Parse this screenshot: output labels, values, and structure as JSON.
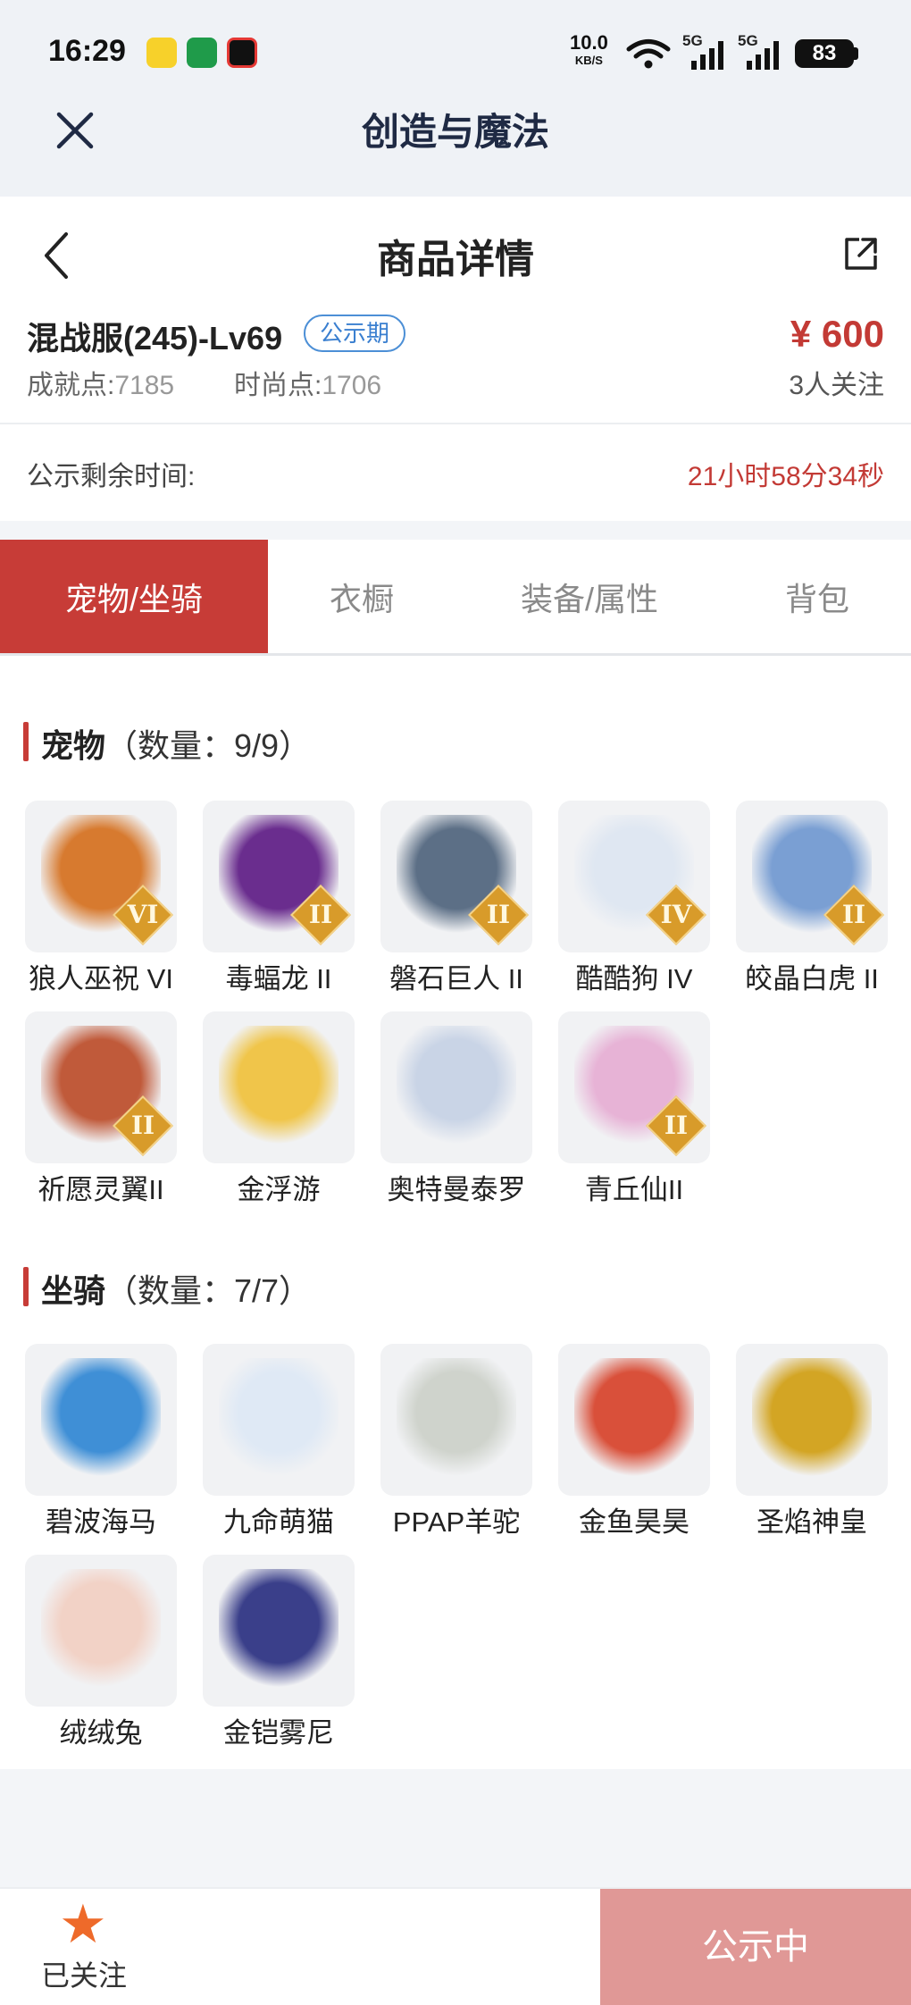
{
  "status_bar": {
    "time": "16:29",
    "net_speed": "10.0",
    "net_unit": "KB/S",
    "signal1": "5G",
    "signal2": "5G",
    "battery": "83"
  },
  "app": {
    "title": "创造与魔法"
  },
  "page": {
    "title": "商品详情"
  },
  "product": {
    "name": "混战服(245)-Lv69",
    "status_tag": "公示期",
    "price": "¥ 600",
    "achievement_label": "成就点:",
    "achievement_value": "7185",
    "fashion_label": "时尚点:",
    "fashion_value": "1706",
    "followers": "3人关注"
  },
  "timer": {
    "label": "公示剩余时间:",
    "value": "21小时58分34秒"
  },
  "tabs": [
    {
      "label": "宠物/坐骑"
    },
    {
      "label": "衣橱"
    },
    {
      "label": "装备/属性"
    },
    {
      "label": "背包"
    }
  ],
  "pets": {
    "title": "宠物",
    "count": "（数量：9/9）",
    "items": [
      {
        "name": "狼人巫祝 VI",
        "tier": "VI",
        "color": "#d77a2f"
      },
      {
        "name": "毒蝠龙 II",
        "tier": "II",
        "color": "#6a2d8e"
      },
      {
        "name": "磐石巨人 II",
        "tier": "II",
        "color": "#5c6f86"
      },
      {
        "name": "酷酷狗 IV",
        "tier": "IV",
        "color": "#dfe7f2"
      },
      {
        "name": "皎晶白虎 II",
        "tier": "II",
        "color": "#7a9fd3"
      },
      {
        "name": "祈愿灵翼II",
        "tier": "II",
        "color": "#c05a3a"
      },
      {
        "name": "金浮游",
        "tier": "",
        "color": "#f0c54a"
      },
      {
        "name": "奥特曼泰罗",
        "tier": "",
        "color": "#c9d4e6"
      },
      {
        "name": "青丘仙II",
        "tier": "II",
        "color": "#e7b3d6"
      }
    ]
  },
  "mounts": {
    "title": "坐骑",
    "count": "（数量：7/7）",
    "items": [
      {
        "name": "碧波海马",
        "tier": "",
        "color": "#3f8fd6"
      },
      {
        "name": "九命萌猫",
        "tier": "",
        "color": "#dfe9f5"
      },
      {
        "name": "PPAP羊驼",
        "tier": "",
        "color": "#cfd3cc"
      },
      {
        "name": "金鱼昊昊",
        "tier": "",
        "color": "#d9503a"
      },
      {
        "name": "圣焰神皇",
        "tier": "",
        "color": "#d3a524"
      },
      {
        "name": "绒绒兔",
        "tier": "",
        "color": "#f2d2c6"
      },
      {
        "name": "金铠雾尼",
        "tier": "",
        "color": "#3a3f8a"
      }
    ]
  },
  "bottom": {
    "follow_label": "已关注",
    "action_label": "公示中"
  }
}
